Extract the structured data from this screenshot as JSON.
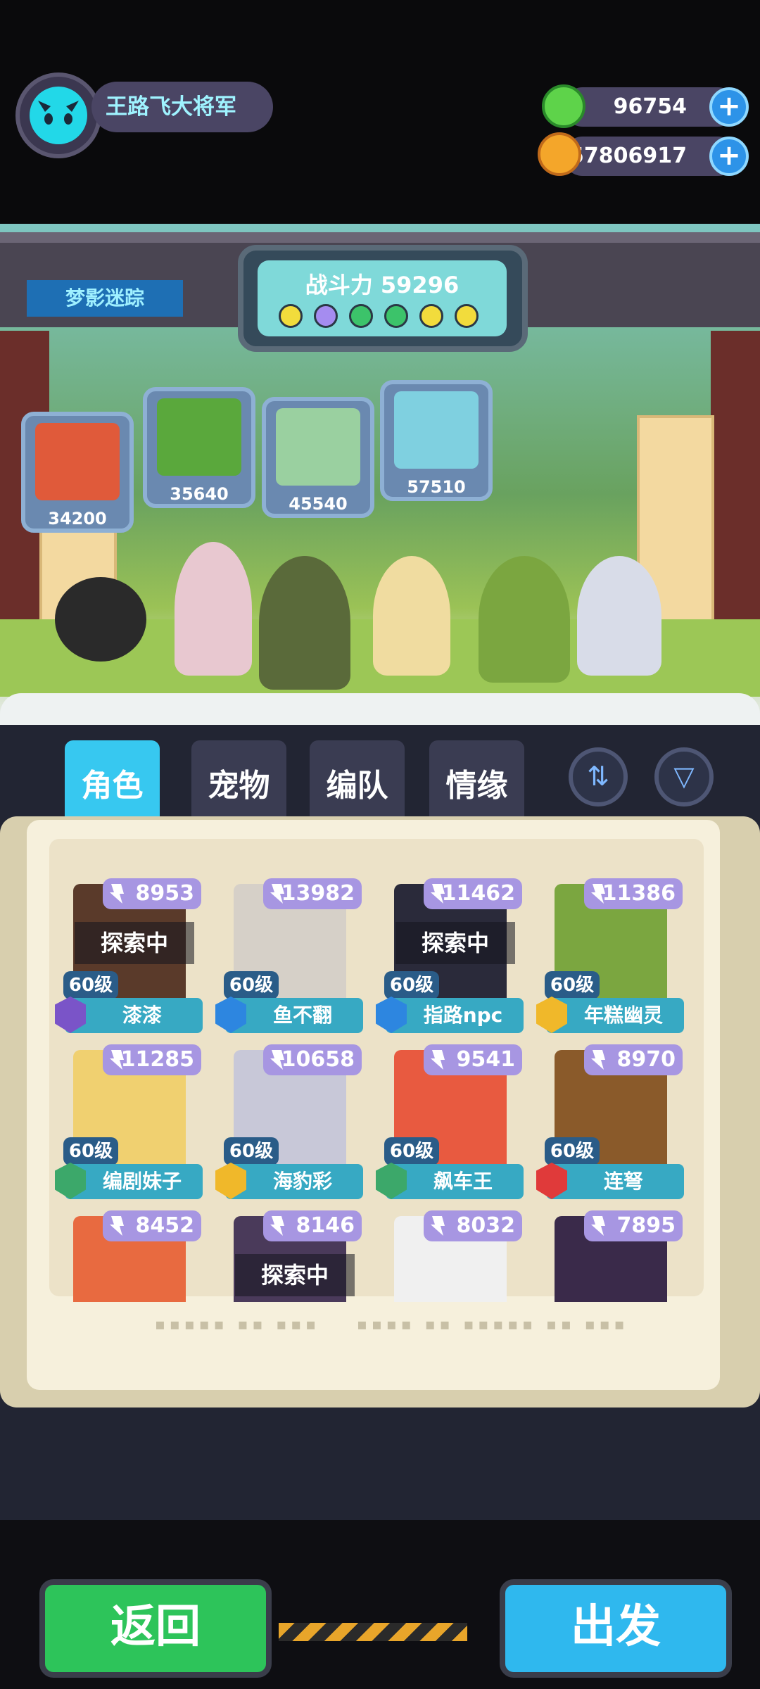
{
  "player": {
    "name": "王路飞大将军"
  },
  "resources": [
    {
      "name": "green-coin",
      "value": "96754",
      "color": "#5ed34a"
    },
    {
      "name": "gold-planet",
      "value": "57806917",
      "color": "#f4a62a"
    }
  ],
  "stage": {
    "banner": "梦影迷踪",
    "power_label": "战斗力 59296",
    "power_dots": [
      "#f2dc3c",
      "#a58cf0",
      "#3cc36a",
      "#3cc36a",
      "#f2dc3c",
      "#f2dc3c"
    ]
  },
  "pets": [
    {
      "value": "34200",
      "color": "#e05a3a"
    },
    {
      "value": "35640",
      "color": "#5aa83c"
    },
    {
      "value": "45540",
      "color": "#9ad0a0"
    },
    {
      "value": "57510",
      "color": "#7fd0e0"
    }
  ],
  "tabs": [
    {
      "label": "角色",
      "active": true
    },
    {
      "label": "宠物",
      "active": false
    },
    {
      "label": "编队",
      "active": false
    },
    {
      "label": "情缘",
      "active": false
    }
  ],
  "characters": [
    {
      "power": "8953",
      "level": "60级",
      "name": "漆漆",
      "status": "探索中",
      "badge": "#7a54c8",
      "art": "#5a3a2a"
    },
    {
      "power": "13982",
      "level": "60级",
      "name": "鱼不翻",
      "status": "",
      "badge": "#2d86e0",
      "art": "#d6d0c8"
    },
    {
      "power": "11462",
      "level": "60级",
      "name": "指路npc",
      "status": "探索中",
      "badge": "#2d86e0",
      "art": "#2a2a3a"
    },
    {
      "power": "11386",
      "level": "60级",
      "name": "年糕幽灵",
      "status": "",
      "badge": "#f0b82a",
      "art": "#7ba640"
    },
    {
      "power": "11285",
      "level": "60级",
      "name": "编剧妹子",
      "status": "",
      "badge": "#3ca86a",
      "art": "#f0d070"
    },
    {
      "power": "10658",
      "level": "60级",
      "name": "海豹彩",
      "status": "",
      "badge": "#f0b82a",
      "art": "#c8c8d8"
    },
    {
      "power": "9541",
      "level": "60级",
      "name": "飙车王",
      "status": "",
      "badge": "#3ca86a",
      "art": "#e85a40"
    },
    {
      "power": "8970",
      "level": "60级",
      "name": "连弩",
      "status": "",
      "badge": "#e03a3a",
      "art": "#8a5a2a"
    },
    {
      "power": "8452",
      "level": "",
      "name": "",
      "status": "",
      "badge": "",
      "art": "#e86a40"
    },
    {
      "power": "8146",
      "level": "",
      "name": "",
      "status": "探索中",
      "badge": "",
      "art": "#4a3a5a"
    },
    {
      "power": "8032",
      "level": "",
      "name": "",
      "status": "",
      "badge": "",
      "art": "#f0f0f0"
    },
    {
      "power": "7895",
      "level": "",
      "name": "",
      "status": "",
      "badge": "",
      "art": "#3a2a4a"
    }
  ],
  "buttons": {
    "back": "返回",
    "go": "出发"
  }
}
